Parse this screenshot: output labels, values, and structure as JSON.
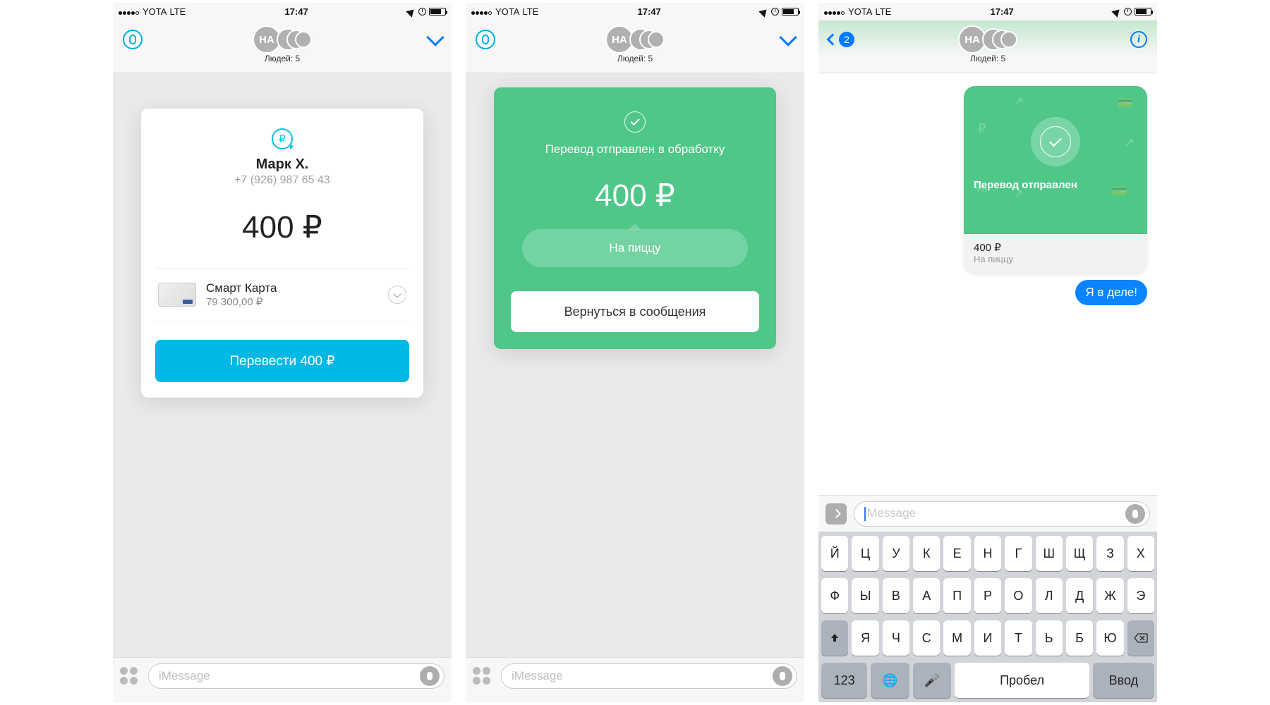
{
  "status": {
    "carrier": "YOTA",
    "net": "LTE",
    "time": "17:47"
  },
  "header": {
    "avatar_initials": "НА",
    "people_label": "Людей: 5",
    "back_count": "2"
  },
  "screen1": {
    "recipient_name": "Марк Х.",
    "recipient_phone": "+7 (926) 987 65 43",
    "amount": "400 ₽",
    "card_name": "Смарт Карта",
    "card_balance": "79 300,00 ₽",
    "button": "Перевести 400 ₽"
  },
  "screen2": {
    "status": "Перевод отправлен в обработку",
    "amount": "400 ₽",
    "note": "На пиццу",
    "button": "Вернуться в сообщения"
  },
  "screen3": {
    "bubble_title": "Перевод отправлен",
    "bubble_amount": "400 ₽",
    "bubble_note": "На пиццу",
    "user_message": "Я в деле!"
  },
  "compose": {
    "placeholder": "iMessage",
    "placeholder_en": "Message"
  },
  "keyboard": {
    "row1": [
      "Й",
      "Ц",
      "У",
      "К",
      "Е",
      "Н",
      "Г",
      "Ш",
      "Щ",
      "З",
      "Х"
    ],
    "row2": [
      "Ф",
      "Ы",
      "В",
      "А",
      "П",
      "Р",
      "О",
      "Л",
      "Д",
      "Ж",
      "Э"
    ],
    "row3": [
      "Я",
      "Ч",
      "С",
      "М",
      "И",
      "Т",
      "Ь",
      "Б",
      "Ю"
    ],
    "num": "123",
    "space": "Пробел",
    "enter": "Ввод"
  }
}
